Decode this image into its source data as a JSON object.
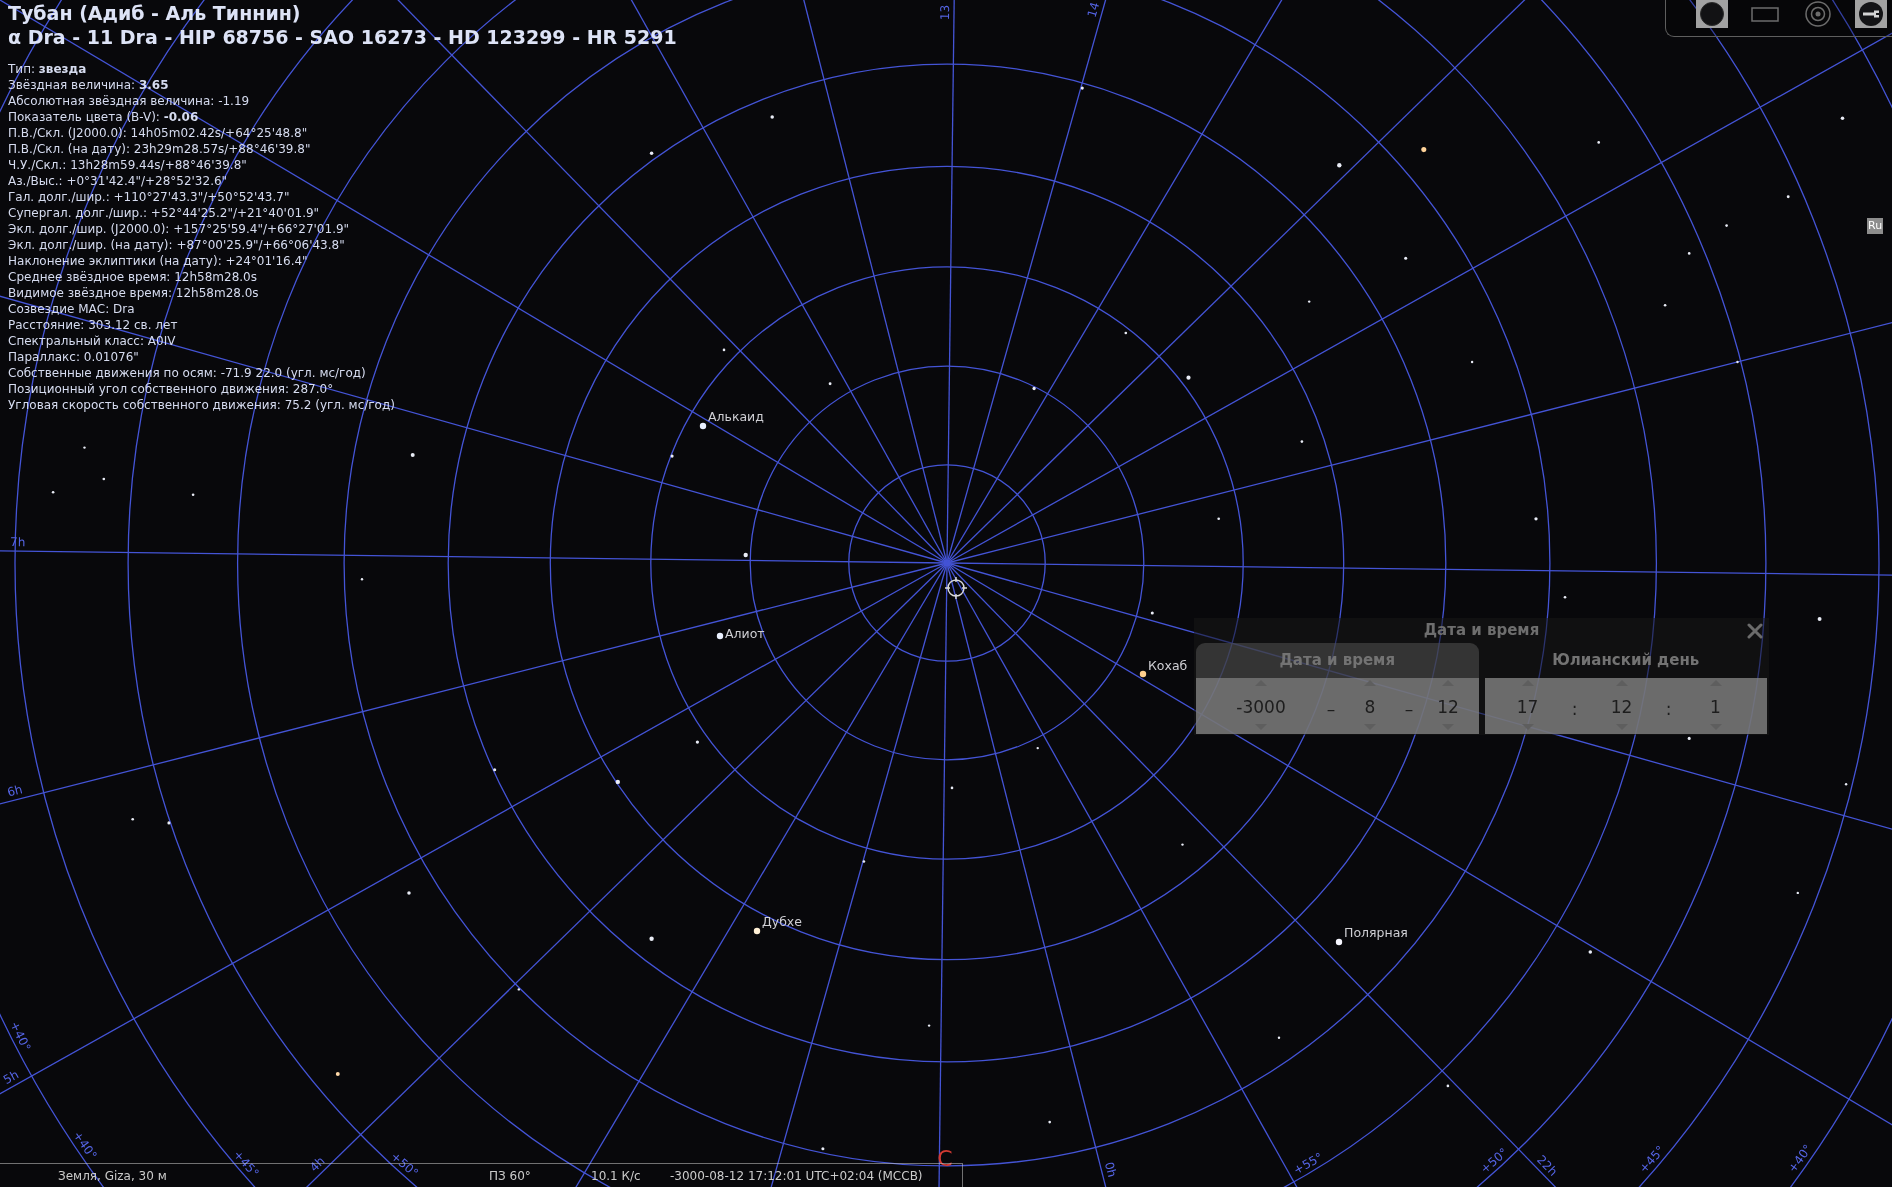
{
  "object_info": {
    "name": "Тубан (Адиб - Аль Тиннин)",
    "designations": "α Dra - 11 Dra - HIP 68756 - SAO 16273 - HD 123299 - HR 5291",
    "lines": [
      "Тип: **звезда**",
      "Звёздная величина: **3.65**",
      "Абсолютная звёздная величина: -1.19",
      "Показатель цвета (B-V): **-0.06**",
      "П.В./Скл. (J2000.0): 14h05m02.42s/+64°25'48.8\"",
      "П.В./Скл. (на дату): 23h29m28.57s/+88°46'39.8\"",
      "Ч.У./Скл.: 13h28m59.44s/+88°46'39.8\"",
      "Аз./Выс.: +0°31'42.4\"/+28°52'32.6\"",
      "Гал. долг./шир.: +110°27'43.3\"/+50°52'43.7\"",
      "Супергал. долг./шир.: +52°44'25.2\"/+21°40'01.9\"",
      "Экл. долг./шир. (J2000.0): +157°25'59.4\"/+66°27'01.9\"",
      "Экл. долг./шир. (на дату): +87°00'25.9\"/+66°06'43.8\"",
      "Наклонение эклиптики (на дату): +24°01'16.4\"",
      "Среднее звёздное время: 12h58m28.0s",
      "Видимое звёздное время: 12h58m28.0s",
      "Созвездие МАС: Dra",
      "Расстояние: 303.12 св. лет",
      "Спектральный класс: A0IV",
      "Параллакс: 0.01076\"",
      "Собственные движения по осям: -71.9 22.0 (угл. мс/год)",
      "Позиционный угол собственного движения: 287.0°",
      "Угловая скорость собственного движения: 75.2 (угл. мс/год)"
    ]
  },
  "toolbar": {
    "buttons": [
      {
        "active": true
      },
      {
        "active": false
      },
      {
        "active": false
      },
      {
        "active": true
      }
    ]
  },
  "language_indicator": "Ru",
  "grid_labels": [
    "7h",
    "6h",
    "+40°",
    "5h",
    "+40°",
    "+45°",
    "4h",
    "+50°",
    "0h",
    "+55°",
    "+50°",
    "22h",
    "+45°",
    "+40°",
    "13",
    "14"
  ],
  "star_labels": [
    "Алькаид",
    "Алиот",
    "Кохаб",
    "Дубхе",
    "Полярная"
  ],
  "cardinal_point": "С",
  "date_time_dialog": {
    "title": "Дата и время",
    "sections": [
      {
        "label": "Дата и время",
        "selected": true,
        "fields": [
          "-3000",
          "8",
          "12"
        ],
        "separators": [
          "–",
          "–"
        ]
      },
      {
        "label": "Юлианский день",
        "selected": false,
        "fields": [
          "17",
          "12",
          "1"
        ],
        "separators": [
          ":",
          ":"
        ]
      }
    ]
  },
  "status_bar": {
    "location": "Земля, Giza, 30 м",
    "field_of_view": "ПЗ 60°",
    "frame_rate": "10.1 К/с",
    "date_time": "-3000-08-12 17:12:01 UTC+02:04 (МССВ)"
  }
}
